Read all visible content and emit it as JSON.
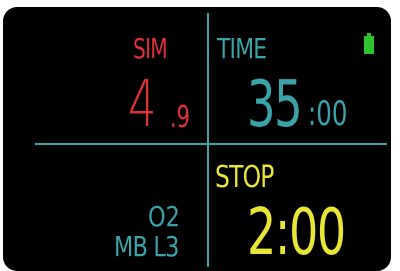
{
  "display": {
    "sim_label": "SIM",
    "depth": {
      "whole": "4",
      "decimal": ".9"
    },
    "time_label": "TIME",
    "dive_time": {
      "minutes": "35",
      "seconds": ":00"
    },
    "stop_label": "STOP",
    "stop_time": "2:00",
    "gas_label": "O2",
    "mb_label": "MB L3",
    "battery_icon": "battery-full-icon",
    "colors": {
      "background": "#000000",
      "divider": "#3aa3a8",
      "sim": "#e0303c",
      "teal": "#3aa3a8",
      "stop": "#e8e635",
      "battery": "#2ec22e"
    }
  }
}
